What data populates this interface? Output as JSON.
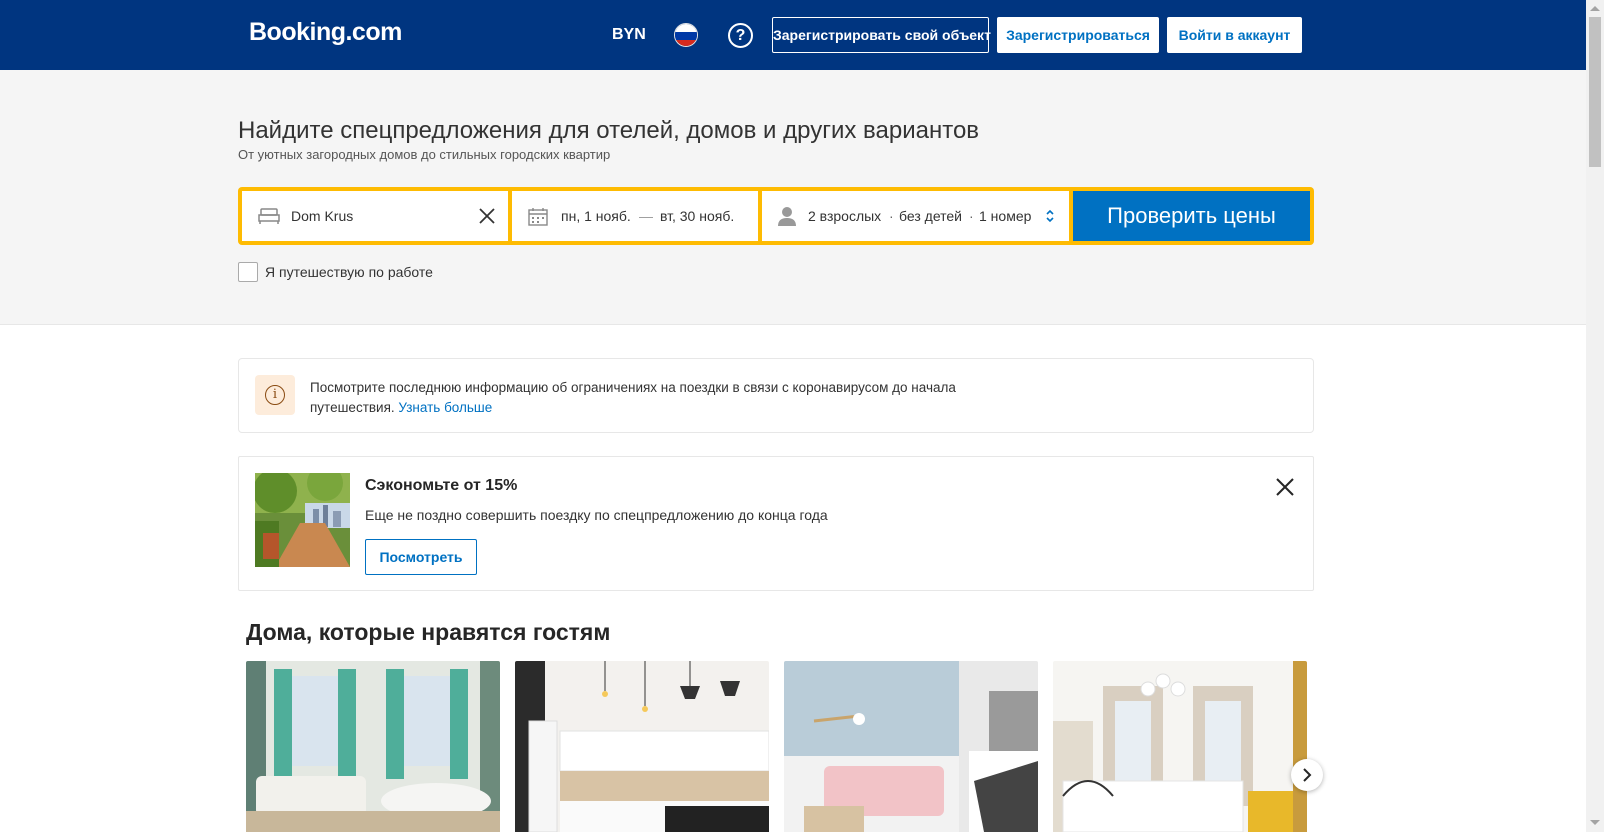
{
  "header": {
    "logo": "Booking.com",
    "currency": "BYN",
    "language_flag": "russia-flag",
    "help_icon": "question-icon",
    "register_property": "Зарегистрировать свой объект",
    "register": "Зарегистрироваться",
    "login": "Войти в аккаунт",
    "bg_color": "#003580"
  },
  "hero": {
    "title": "Найдите спецпредложения для отелей, домов и других вариантов",
    "subtitle": "От уютных загородных домов до стильных городских квартир",
    "search": {
      "destination_value": "Dom Krus",
      "checkin": "пн, 1 нояб.",
      "dash": "—",
      "checkout": "вт, 30 нояб.",
      "adults": "2 взрослых",
      "children": "без детей",
      "rooms": "1 номер",
      "separator": "·",
      "submit": "Проверить цены",
      "accent_color": "#febb02",
      "button_color": "#0071c2"
    },
    "business_travel_label": "Я путешествую по работе",
    "business_travel_checked": false
  },
  "notice": {
    "text": "Посмотрите последнюю информацию об ограничениях на поездки в связи с коронавирусом до начала путешествия.",
    "link": "Узнать больше",
    "icon": "info-icon"
  },
  "promo": {
    "title": "Сэкономьте от 15%",
    "description": "Еще не поздно совершить поездку по спецпредложению до конца года",
    "button": "Посмотреть",
    "close_icon": "close-icon"
  },
  "homes": {
    "title": "Дома, которые нравятся гостям",
    "next_icon": "chevron-right-icon"
  }
}
